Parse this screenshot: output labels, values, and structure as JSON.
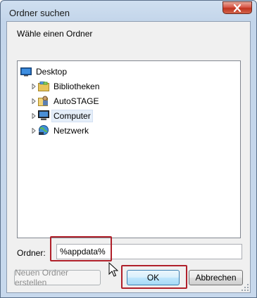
{
  "window": {
    "title": "Ordner suchen"
  },
  "dialog": {
    "prompt": "Wähle einen Ordner",
    "tree": [
      {
        "label": "Desktop",
        "icon": "desktop-icon",
        "expandable": false,
        "selected": false
      },
      {
        "label": "Bibliotheken",
        "icon": "libraries-icon",
        "expandable": true,
        "selected": false
      },
      {
        "label": "AutoSTAGE",
        "icon": "user-folder-icon",
        "expandable": true,
        "selected": false
      },
      {
        "label": "Computer",
        "icon": "computer-icon",
        "expandable": true,
        "selected": true
      },
      {
        "label": "Netzwerk",
        "icon": "network-icon",
        "expandable": true,
        "selected": false
      }
    ],
    "folder_label": "Ordner:",
    "folder_value": "%appdata%",
    "new_folder_button": "Neuen Ordner erstellen",
    "ok_button": "OK",
    "cancel_button": "Abbrechen"
  },
  "colors": {
    "highlight": "#b0202a",
    "close_button": "#c0341f"
  }
}
